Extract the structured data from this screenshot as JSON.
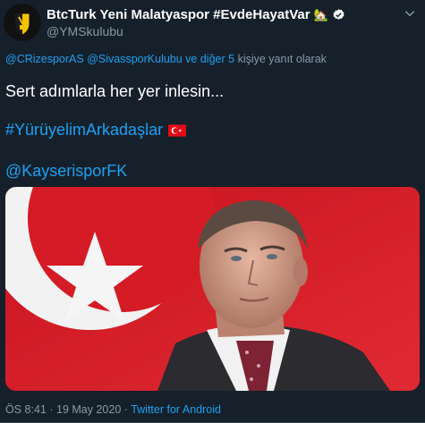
{
  "author": {
    "display_name": "BtcTurk Yeni Malatyaspor #EvdeHayatVar",
    "handle": "@YMSkulubu",
    "status_emoji_icon": "house-emoji-icon",
    "verified": true
  },
  "reply_context": {
    "mention_1": "@CRizesporAS",
    "mention_2": "@SivassporKulubu ve diğer 5",
    "suffix": "kişiye yanıt olarak"
  },
  "tweet": {
    "line1": "Sert adımlarla her yer inlesin...",
    "hashtag": "#YürüyelimArkadaşlar",
    "hashtag_emoji_icon": "turkey-flag-icon",
    "mention": "@KayserisporFK"
  },
  "media": {
    "description_icon": "photo-portrait-with-turkish-flag"
  },
  "meta": {
    "time": "ÖS 8:41",
    "date": "19 May 2020",
    "separator": "·",
    "source": "Twitter for Android"
  },
  "colors": {
    "background": "#15202b",
    "text": "#ffffff",
    "secondary": "#8899a6",
    "link": "#1da1f2",
    "divider": "#38444d"
  }
}
